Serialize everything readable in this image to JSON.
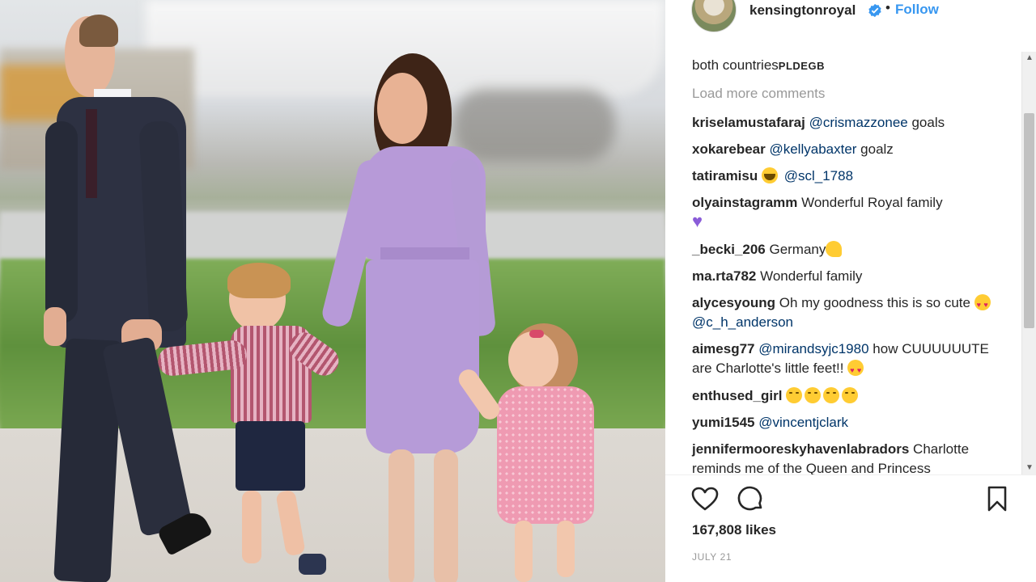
{
  "header": {
    "username": "kensingtonroyal",
    "separator": "•",
    "follow_label": "Follow",
    "avatar_icon": "profile-avatar",
    "verified_icon": "verified-badge-icon"
  },
  "comments_area": {
    "caption_tail_text": "both countries",
    "caption_tail_suffix": "PLDEGB",
    "load_more_label": "Load more comments",
    "items": [
      {
        "user": "kriselamustafaraj",
        "mention": "@crismazzonee",
        "text": " goals"
      },
      {
        "user": "xokarebear",
        "mention": "@kellyabaxter",
        "text": " goalz"
      },
      {
        "user": "tatiramisu",
        "mention": "@scl_1788",
        "emoji": "crying-emoji"
      },
      {
        "user": "olyainstagramm",
        "text": " Wonderful Royal family",
        "emoji": "purple-heart"
      },
      {
        "user": "_becki_206",
        "text": " Germany",
        "emoji": "flexed-biceps"
      },
      {
        "user": "ma.rta782",
        "text": " Wonderful family"
      },
      {
        "user": "alycesyoung",
        "text": " Oh my goodness this is so cute ",
        "mention": "@c_h_anderson",
        "emoji": "heart-eyes"
      },
      {
        "user": "aimesg77",
        "mention": "@mirandsyjc1980",
        "text": " how CUUUUUUTE are Charlotte's little feet!! ",
        "emoji": "heart-eyes"
      },
      {
        "user": "enthused_girl",
        "emoji": "yum-face"
      },
      {
        "user": "yumi1545",
        "mention": "@vincentjclark"
      },
      {
        "user": "jennifermooreskyhavenlabradors",
        "text": " Charlotte reminds me of the Queen and Princess"
      }
    ]
  },
  "actions": {
    "like_icon": "heart-outline-icon",
    "comment_icon": "comment-bubble-icon",
    "save_icon": "bookmark-icon"
  },
  "likes_text": "167,808 likes",
  "date_text": "JULY 21",
  "scrollbar": {
    "up": "▲",
    "down": "▼"
  },
  "colors": {
    "follow": "#3897f0",
    "text": "#262626",
    "muted": "#999999",
    "mention": "#003569"
  }
}
